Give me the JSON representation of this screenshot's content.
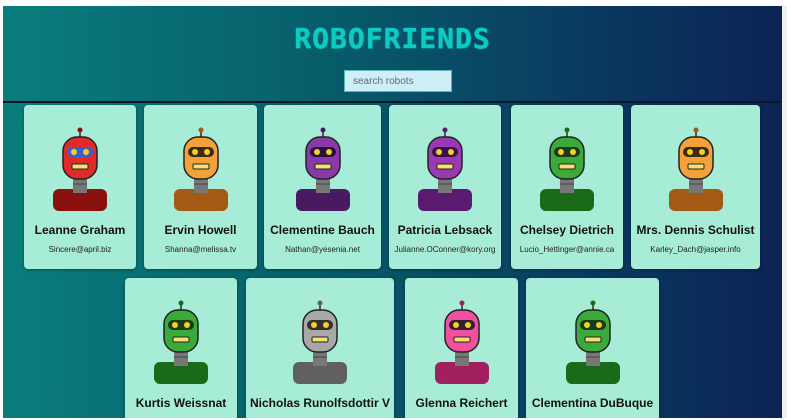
{
  "app": {
    "title": "ROBOFRIENDS",
    "search": {
      "placeholder": "search robots",
      "value": ""
    }
  },
  "robots": [
    {
      "name": "Leanne Graham",
      "email": "Sincere@april.biz",
      "colors": {
        "body": "#e02a2a",
        "dark": "#8a1010",
        "visor": "#3a5fd0"
      }
    },
    {
      "name": "Ervin Howell",
      "email": "Shanna@melissa.tv",
      "colors": {
        "body": "#f5a13a",
        "dark": "#a35a12",
        "visor": "#3a2a10"
      }
    },
    {
      "name": "Clementine Bauch",
      "email": "Nathan@yesenia.net",
      "colors": {
        "body": "#8a3aa8",
        "dark": "#4a1a60",
        "visor": "#2a1040"
      }
    },
    {
      "name": "Patricia Lebsack",
      "email": "Julianne.OConner@kory.org",
      "colors": {
        "body": "#9a3ab0",
        "dark": "#5a1a70",
        "visor": "#3a1050"
      }
    },
    {
      "name": "Chelsey Dietrich",
      "email": "Lucio_Hettinger@annie.ca",
      "colors": {
        "body": "#3aaa3a",
        "dark": "#1a6a1a",
        "visor": "#1a3a1a"
      }
    },
    {
      "name": "Mrs. Dennis Schulist",
      "email": "Karley_Dach@jasper.info",
      "colors": {
        "body": "#f5a13a",
        "dark": "#a35a12",
        "visor": "#3a2a10"
      }
    },
    {
      "name": "Kurtis Weissnat",
      "email": "",
      "colors": {
        "body": "#3aaa3a",
        "dark": "#1a6a1a",
        "visor": "#1a3a1a"
      }
    },
    {
      "name": "Nicholas Runolfsdottir V",
      "email": "",
      "colors": {
        "body": "#a8a8a8",
        "dark": "#606060",
        "visor": "#303030"
      }
    },
    {
      "name": "Glenna Reichert",
      "email": "",
      "colors": {
        "body": "#f050a0",
        "dark": "#a02060",
        "visor": "#302030"
      }
    },
    {
      "name": "Clementina DuBuque",
      "email": "",
      "colors": {
        "body": "#3aaa3a",
        "dark": "#1a6a1a",
        "visor": "#1a3a1a"
      }
    }
  ]
}
